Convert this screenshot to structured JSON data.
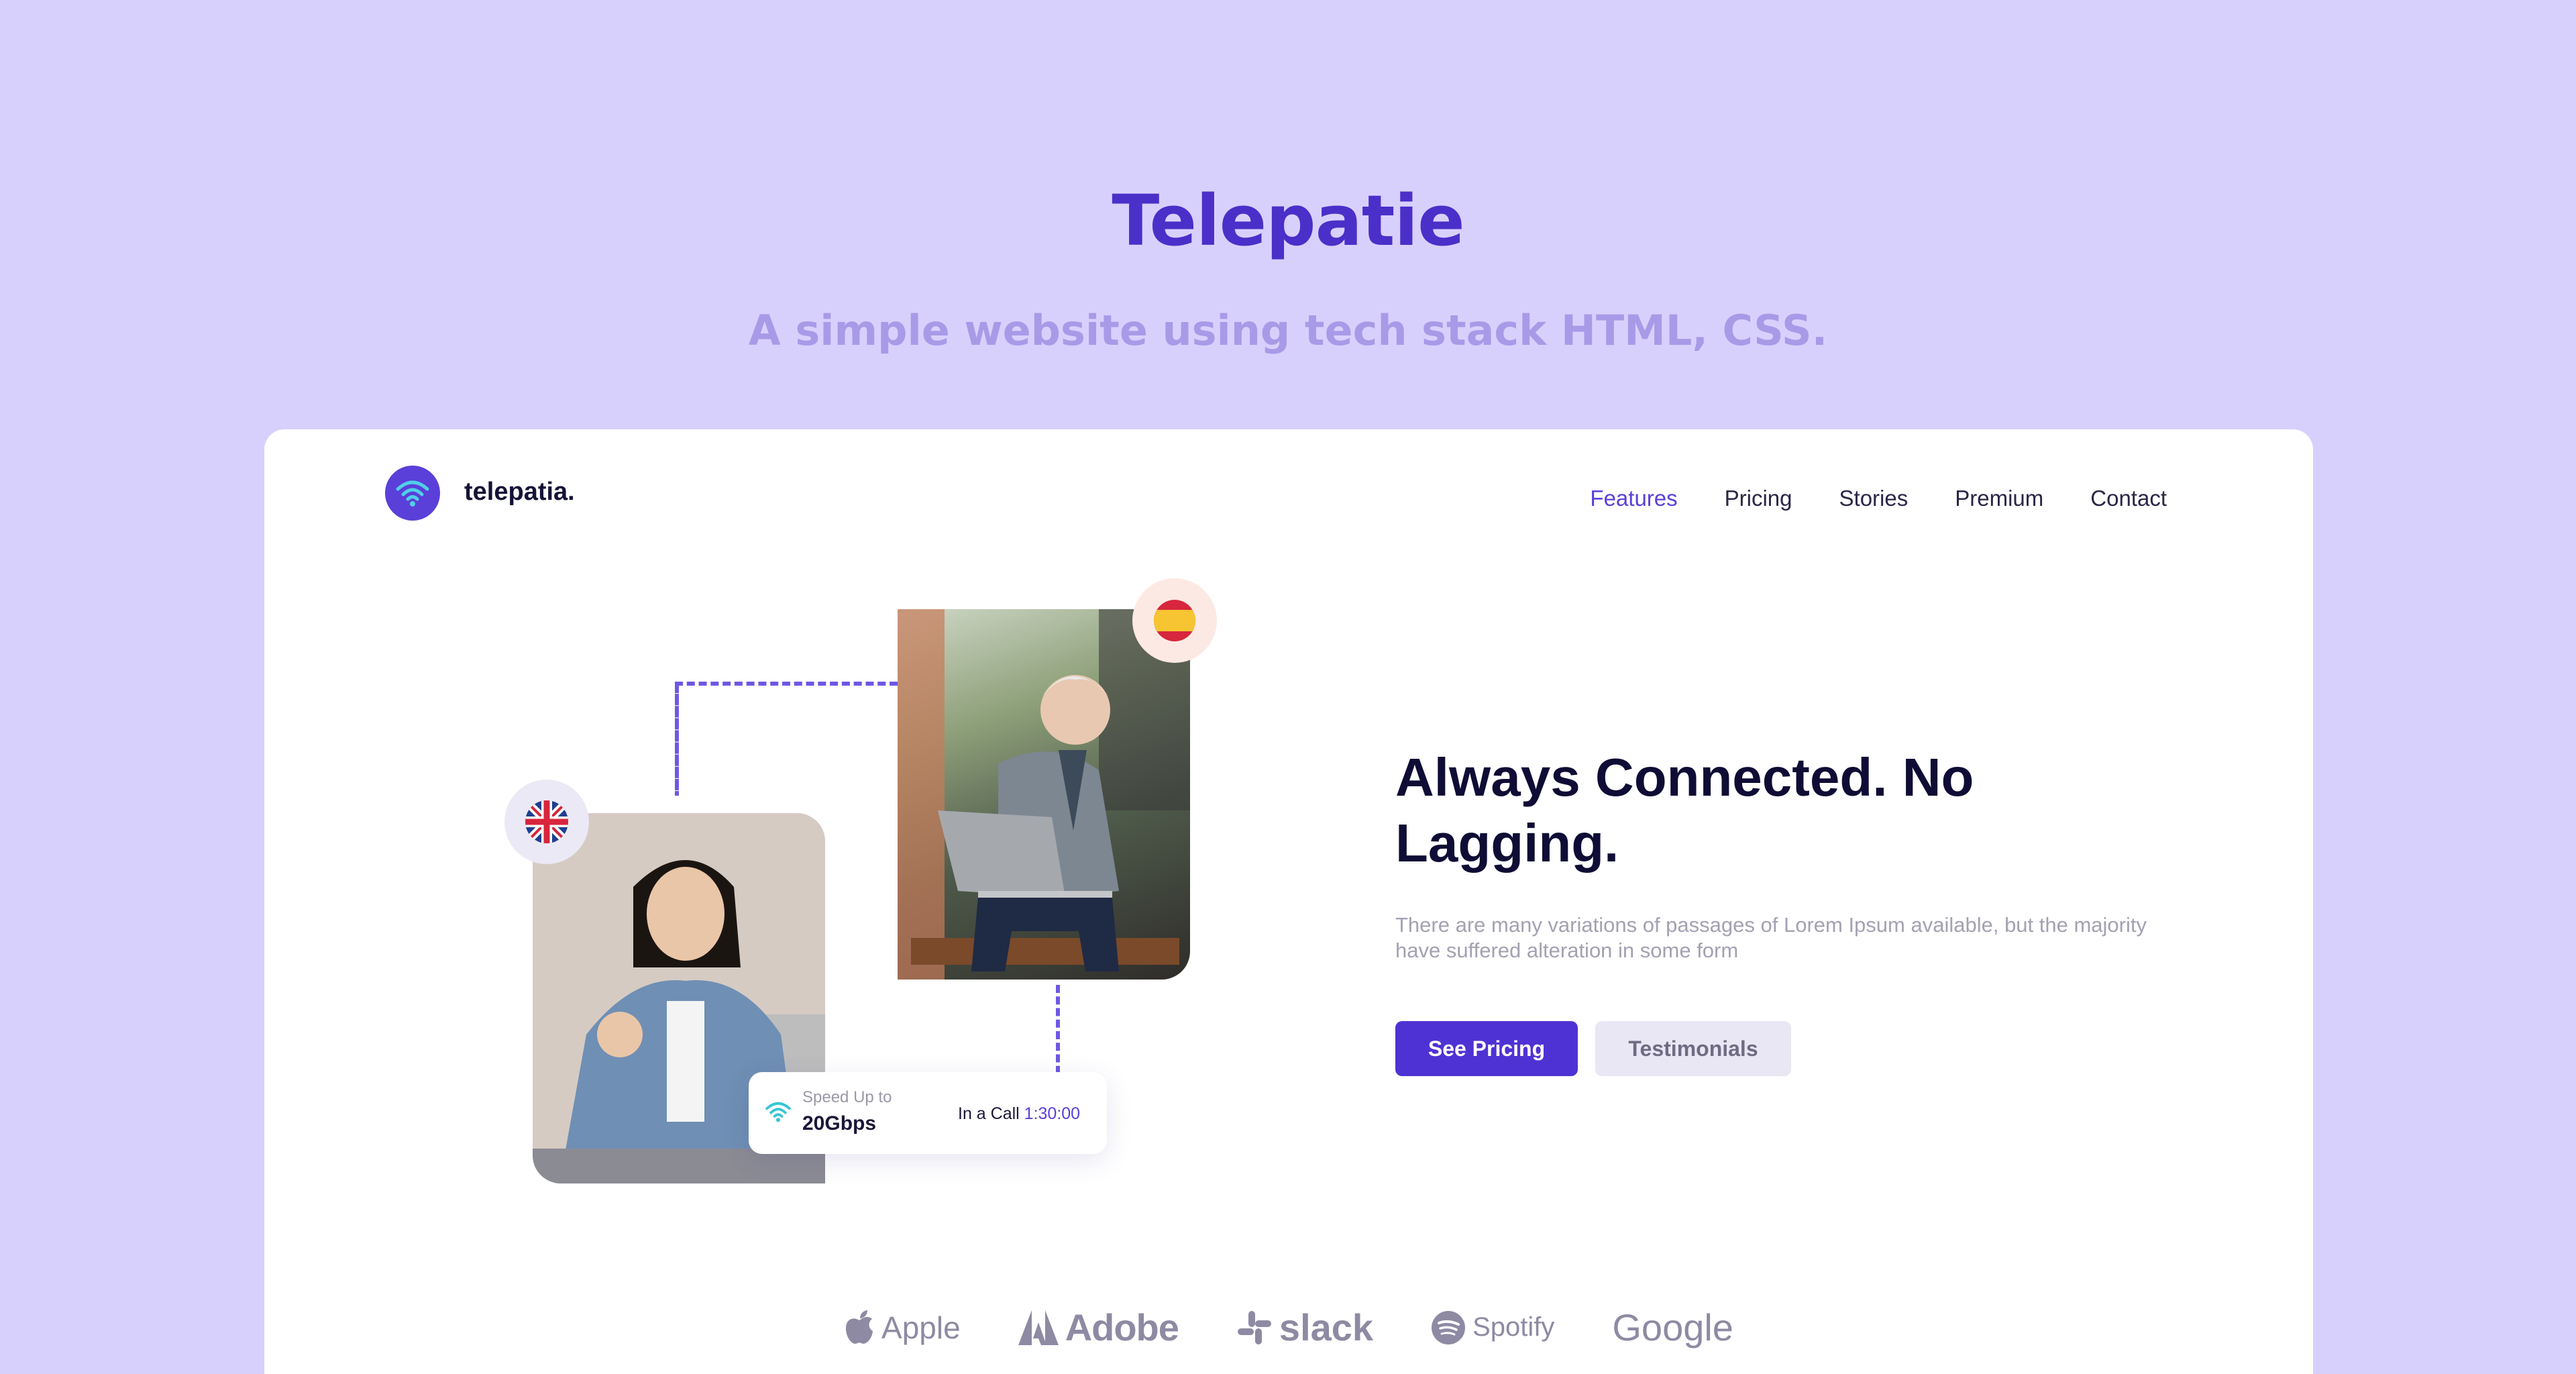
{
  "page": {
    "title": "Telepatie",
    "subtitle": "A simple website using tech stack HTML, CSS."
  },
  "site": {
    "logo_text": "telepatia.",
    "nav": [
      {
        "label": "Features",
        "active": true
      },
      {
        "label": "Pricing",
        "active": false
      },
      {
        "label": "Stories",
        "active": false
      },
      {
        "label": "Premium",
        "active": false
      },
      {
        "label": "Contact",
        "active": false
      }
    ]
  },
  "hero": {
    "title": "Always Connected. No Lagging.",
    "description": "There are many variations of passages of Lorem Ipsum available, but the majority have suffered alteration in some form",
    "primary_button": "See Pricing",
    "secondary_button": "Testimonials"
  },
  "speed_card": {
    "label": "Speed Up to",
    "value": "20Gbps",
    "call_label": "In a Call",
    "call_time": "1:30:00"
  },
  "brands": [
    "Apple",
    "Adobe",
    "slack",
    "Spotify",
    "Google"
  ],
  "colors": {
    "background": "#d8d0fc",
    "accent": "#4f32d3",
    "title": "#4b2fc9",
    "subtitle": "#a99ae8"
  },
  "icons": [
    "wifi-icon",
    "spain-flag-icon",
    "uk-flag-icon",
    "apple-logo-icon",
    "adobe-logo-icon",
    "slack-logo-icon",
    "spotify-logo-icon"
  ]
}
